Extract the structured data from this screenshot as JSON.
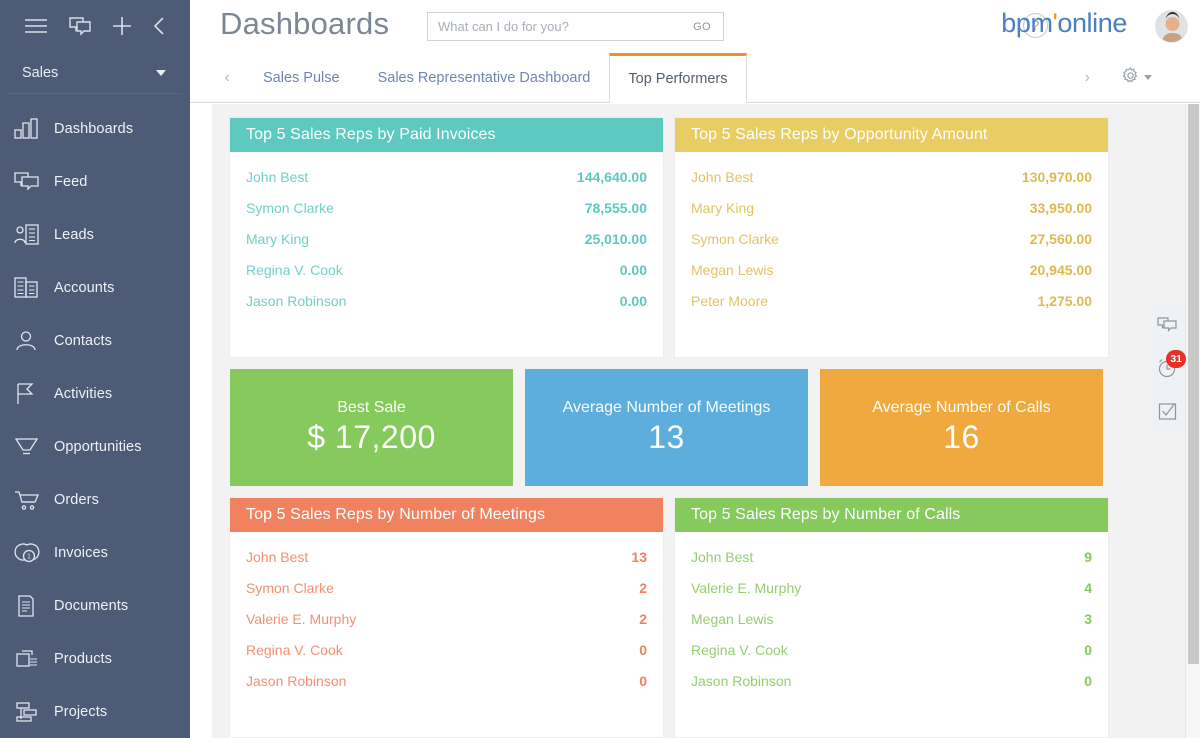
{
  "sidebar": {
    "top_icons": [
      {
        "name": "menu-icon",
        "label": "Menu"
      },
      {
        "name": "chat-icon",
        "label": "Chat"
      },
      {
        "name": "plus-icon",
        "label": "Add"
      },
      {
        "name": "collapse-icon",
        "label": "Collapse"
      }
    ],
    "workspace": "Sales",
    "items": [
      {
        "label": "Dashboards",
        "icon": "bar-chart-icon"
      },
      {
        "label": "Feed",
        "icon": "feed-icon"
      },
      {
        "label": "Leads",
        "icon": "leads-icon"
      },
      {
        "label": "Accounts",
        "icon": "accounts-icon"
      },
      {
        "label": "Contacts",
        "icon": "contacts-icon"
      },
      {
        "label": "Activities",
        "icon": "flag-icon"
      },
      {
        "label": "Opportunities",
        "icon": "funnel-icon"
      },
      {
        "label": "Orders",
        "icon": "cart-icon"
      },
      {
        "label": "Invoices",
        "icon": "coins-icon"
      },
      {
        "label": "Documents",
        "icon": "document-icon"
      },
      {
        "label": "Products",
        "icon": "products-icon"
      },
      {
        "label": "Projects",
        "icon": "projects-icon"
      }
    ]
  },
  "header": {
    "title": "Dashboards",
    "search_placeholder": "What can I do for you?",
    "search_value": "",
    "go_label": "GO",
    "help_label": "?",
    "brand_part1": "bpm",
    "brand_dot": "'",
    "brand_part2": "online"
  },
  "tabs": {
    "prev_label": "‹",
    "next_label": "›",
    "items": [
      {
        "label": "Sales Pulse",
        "active": false
      },
      {
        "label": "Sales Representative Dashboard",
        "active": false
      },
      {
        "label": "Top Performers",
        "active": true
      }
    ]
  },
  "widgets": {
    "paid_invoices": {
      "title": "Top 5 Sales Reps by Paid Invoices",
      "color": "#5ec9c0",
      "rows": [
        {
          "name": "John Best",
          "value": "144,640.00"
        },
        {
          "name": "Symon Clarke",
          "value": "78,555.00"
        },
        {
          "name": "Mary King",
          "value": "25,010.00"
        },
        {
          "name": "Regina V. Cook",
          "value": "0.00"
        },
        {
          "name": "Jason Robinson",
          "value": "0.00"
        }
      ]
    },
    "opportunity_amount": {
      "title": "Top 5 Sales Reps by Opportunity Amount",
      "color": "#e8cc64",
      "rows": [
        {
          "name": "John Best",
          "value": "130,970.00"
        },
        {
          "name": "Mary King",
          "value": "33,950.00"
        },
        {
          "name": "Symon Clarke",
          "value": "27,560.00"
        },
        {
          "name": "Megan Lewis",
          "value": "20,945.00"
        },
        {
          "name": "Peter Moore",
          "value": "1,275.00"
        }
      ]
    },
    "meetings": {
      "title": "Top 5 Sales Reps by Number of Meetings",
      "color": "#f0825f",
      "rows": [
        {
          "name": "John Best",
          "value": "13"
        },
        {
          "name": "Symon Clarke",
          "value": "2"
        },
        {
          "name": "Valerie E. Murphy",
          "value": "2"
        },
        {
          "name": "Regina V. Cook",
          "value": "0"
        },
        {
          "name": "Jason Robinson",
          "value": "0"
        }
      ]
    },
    "calls": {
      "title": "Top 5 Sales Reps by Number of Calls",
      "color": "#86c95c",
      "rows": [
        {
          "name": "John Best",
          "value": "9"
        },
        {
          "name": "Valerie E. Murphy",
          "value": "4"
        },
        {
          "name": "Megan Lewis",
          "value": "3"
        },
        {
          "name": "Regina V. Cook",
          "value": "0"
        },
        {
          "name": "Jason Robinson",
          "value": "0"
        }
      ]
    }
  },
  "kpis": [
    {
      "title": "Best Sale",
      "value": "$ 17,200",
      "color": "#86c95c"
    },
    {
      "title": "Average Number of Meetings",
      "value": "13",
      "color": "#5eaedd"
    },
    {
      "title": "Average Number of Calls",
      "value": "16",
      "color": "#efa93e"
    }
  ],
  "right_panel": {
    "items": [
      {
        "icon": "chat-icon",
        "badge": ""
      },
      {
        "icon": "clock-icon",
        "badge": "31"
      },
      {
        "icon": "task-check-icon",
        "badge": ""
      }
    ],
    "badge_count": "31"
  },
  "chart_data": {
    "type": "table",
    "title": "Top Performers",
    "panels": [
      {
        "title": "Top 5 Sales Reps by Paid Invoices",
        "categories": [
          "John Best",
          "Symon Clarke",
          "Mary King",
          "Regina V. Cook",
          "Jason Robinson"
        ],
        "values": [
          144640.0,
          78555.0,
          25010.0,
          0.0,
          0.0
        ],
        "color": "#5ec9c0"
      },
      {
        "title": "Top 5 Sales Reps by Opportunity Amount",
        "categories": [
          "John Best",
          "Mary King",
          "Symon Clarke",
          "Megan Lewis",
          "Peter Moore"
        ],
        "values": [
          130970.0,
          33950.0,
          27560.0,
          20945.0,
          1275.0
        ],
        "color": "#e8cc64"
      },
      {
        "title": "Top 5 Sales Reps by Number of Meetings",
        "categories": [
          "John Best",
          "Symon Clarke",
          "Valerie E. Murphy",
          "Regina V. Cook",
          "Jason Robinson"
        ],
        "values": [
          13,
          2,
          2,
          0,
          0
        ],
        "color": "#f0825f"
      },
      {
        "title": "Top 5 Sales Reps by Number of Calls",
        "categories": [
          "John Best",
          "Valerie E. Murphy",
          "Megan Lewis",
          "Regina V. Cook",
          "Jason Robinson"
        ],
        "values": [
          9,
          4,
          3,
          0,
          0
        ],
        "color": "#86c95c"
      }
    ],
    "metrics": [
      {
        "label": "Best Sale",
        "value": 17200,
        "display": "$ 17,200"
      },
      {
        "label": "Average Number of Meetings",
        "value": 13,
        "display": "13"
      },
      {
        "label": "Average Number of Calls",
        "value": 16,
        "display": "16"
      }
    ]
  }
}
